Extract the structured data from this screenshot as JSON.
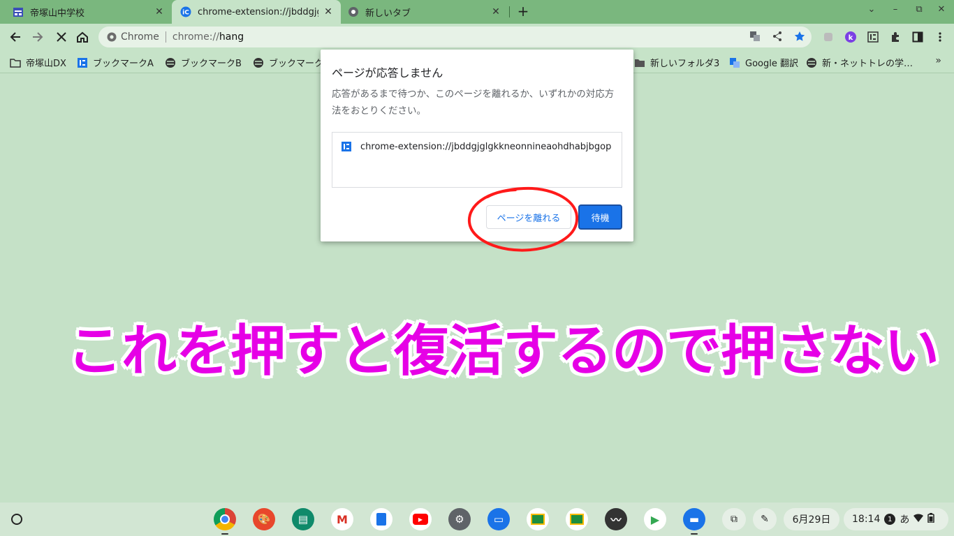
{
  "tabs": [
    {
      "title": "帝塚山中学校",
      "icon": "calendar-grid-icon",
      "active": false
    },
    {
      "title": "chrome-extension://jbddgjglgkkneonnineaohdhabjbgopi",
      "icon": "ic-extension-icon",
      "active": true
    },
    {
      "title": "新しいタブ",
      "icon": "chrome-globe-icon",
      "active": false
    }
  ],
  "tab_close": "✕",
  "new_tab": "+",
  "window_controls": {
    "down": "⌄",
    "minimize": "–",
    "restore": "⧉",
    "close": "✕"
  },
  "omnibox": {
    "origin_label": "Chrome",
    "scheme": "chrome://",
    "host": "hang"
  },
  "bookmarks": [
    {
      "label": "帝塚山DX",
      "icon": "folder-icon"
    },
    {
      "label": "ブックマークA",
      "icon": "ic-icon"
    },
    {
      "label": "ブックマークB",
      "icon": "globe-icon"
    },
    {
      "label": "ブックマーク",
      "icon": "globe-icon"
    },
    {
      "label": "新しいフォルダ3",
      "icon": "folder-icon"
    },
    {
      "label": "Google 翻訳",
      "icon": "translate-icon"
    },
    {
      "label": "新・ネットトレの学…",
      "icon": "globe-icon"
    }
  ],
  "bookmarks_more": "»",
  "dialog": {
    "title": "ページが応答しません",
    "body": "応答があるまで待つか、このページを離れるか、いずれかの対応方法をおとりください。",
    "item": "chrome-extension://jbddgjglgkkneonnineaohdhabjbgopi/manifest",
    "leave_button": "ページを離れる",
    "wait_button": "待機"
  },
  "annotation": "これを押すと復活するので押さない",
  "shelf": {
    "apps": [
      "chrome",
      "canvas",
      "classroom-reader",
      "gmail",
      "docs",
      "youtube",
      "settings",
      "files",
      "classroom",
      "classroom2",
      "stats",
      "play-store",
      "chat"
    ],
    "date": "6月29日",
    "time": "18:14",
    "notification_count": "1",
    "ime": "あ"
  },
  "colors": {
    "accent": "#1a73e8",
    "annotation": "#e600e6",
    "circle": "#ff0000",
    "tabstrip": "#7ab77e",
    "frame": "#c6e3c8"
  }
}
